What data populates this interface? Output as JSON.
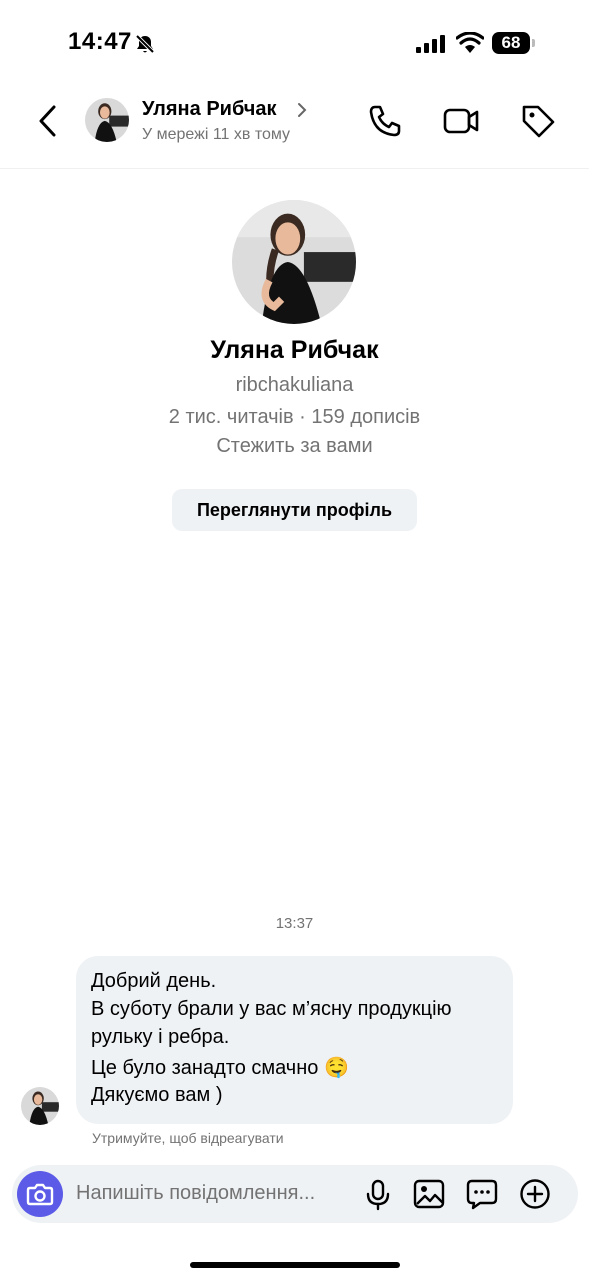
{
  "status_bar": {
    "time": "14:47",
    "battery": "68"
  },
  "header": {
    "name": "Уляна Рибчак",
    "status": "У мережі 11 хв тому"
  },
  "profile": {
    "name": "Уляна Рибчак",
    "username": "ribchakuliana",
    "stats": "2 тис. читачів · 159 дописів",
    "follow_status": "Стежить за вами",
    "view_button": "Переглянути профіль"
  },
  "chat": {
    "timestamp": "13:37",
    "message_lines": [
      "Добрий день.",
      "В суботу брали у вас м’ясну продукцію",
      "рульку і ребра.",
      "Це було занадто смачно 🤤",
      "Дякуємо вам )"
    ],
    "hint": "Утримуйте, щоб відреагувати"
  },
  "composer": {
    "placeholder": "Напишіть повідомлення..."
  },
  "colors": {
    "accent": "#5b5be8",
    "bubble": "#eff2f5",
    "secondary_text": "#737373"
  }
}
